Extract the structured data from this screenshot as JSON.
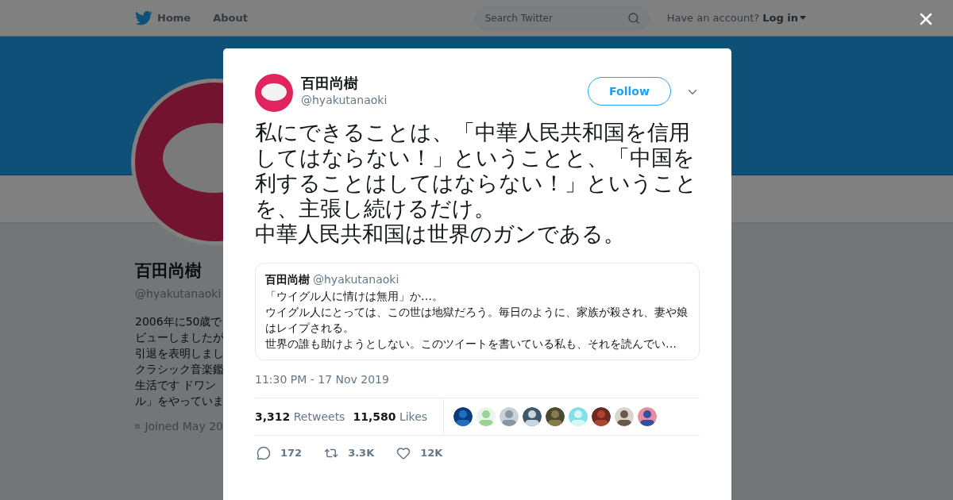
{
  "nav": {
    "items": [
      {
        "label": "Home"
      },
      {
        "label": "About"
      }
    ],
    "search": {
      "placeholder": "Search Twitter"
    },
    "account_prompt": "Have an account?",
    "login": "Log in"
  },
  "profile": {
    "name": "百田尚樹",
    "handle": "@hyakutanaoki",
    "bio_lines": [
      "2006年に50歳で",
      "ビューしましたが",
      "引退を表明しまし",
      "クラシック音楽鑑",
      "生活です ドワン",
      "ル」をやっていま"
    ],
    "joined": "Joined May 20"
  },
  "tweet": {
    "author": {
      "name": "百田尚樹",
      "handle": "@hyakutanaoki"
    },
    "follow_label": "Follow",
    "paragraphs": [
      "私にできることは、「中華人民共和国を信用してはならない！」ということと、「中国を利することはしてはならない！」ということを、主張し続けるだけ。",
      "中華人民共和国は世界のガンである。"
    ],
    "quote": {
      "name": "百田尚樹",
      "handle": "@hyakutanaoki",
      "paragraphs": [
        "「ウイグル人に情けは無用」か…。",
        "ウイグル人にとっては、この世は地獄だろう。毎日のように、家族が殺され、妻や娘はレイプされる。",
        "世界の誰も助けようとしない。このツイートを書いている私も、それを読んでい…"
      ]
    },
    "timestamp": "11:30 PM - 17 Nov 2019",
    "stats": [
      {
        "count": "3,312",
        "label": "Retweets"
      },
      {
        "count": "11,580",
        "label": "Likes"
      }
    ],
    "likers": [
      {
        "kind": "picture"
      },
      {
        "kind": "picture"
      },
      {
        "kind": "picture"
      },
      {
        "kind": "picture"
      },
      {
        "kind": "picture"
      },
      {
        "kind": "picture"
      },
      {
        "kind": "picture"
      },
      {
        "kind": "picture"
      },
      {
        "kind": "picture"
      }
    ],
    "actions": [
      {
        "kind": "reply",
        "count": "172"
      },
      {
        "kind": "retweet",
        "count": "3.3K"
      },
      {
        "kind": "like",
        "count": "12K"
      }
    ]
  }
}
